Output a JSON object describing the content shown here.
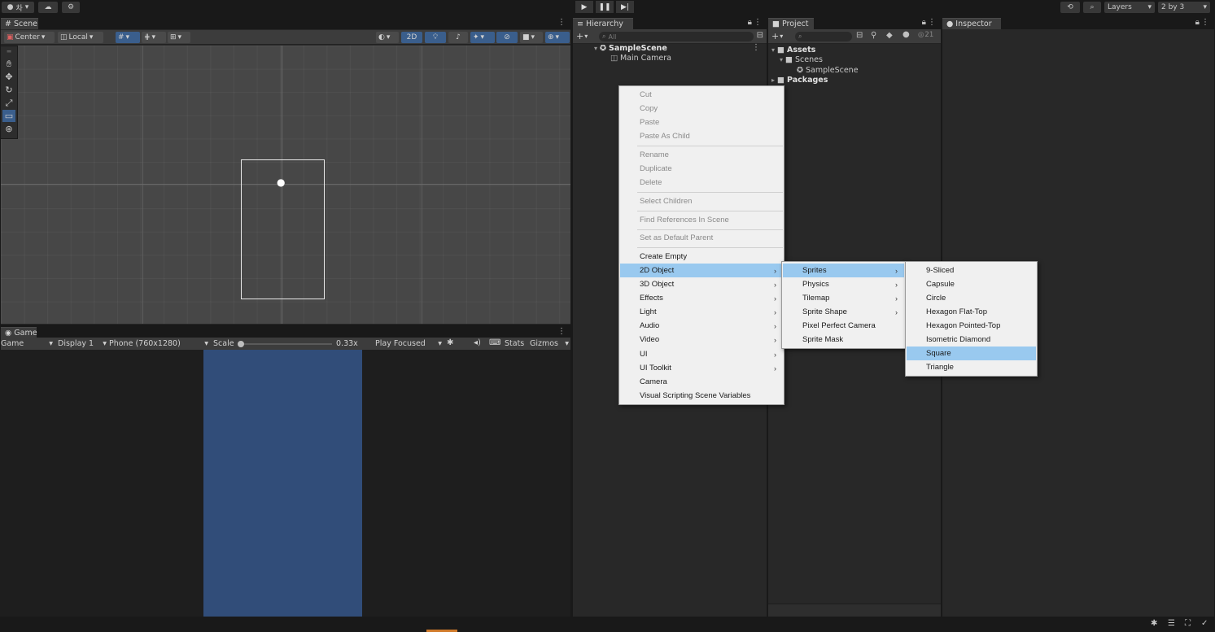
{
  "toolbar": {
    "account_label": "차",
    "layers_label": "Layers",
    "layout_label": "2 by 3"
  },
  "scene": {
    "tab_label": "Scene",
    "center_label": "Center",
    "local_label": "Local",
    "mode_2d_label": "2D"
  },
  "game": {
    "tab_label": "Game",
    "game_dropdown": "Game",
    "display_label": "Display 1",
    "resolution_label": "Phone (760x1280)",
    "scale_label": "Scale",
    "scale_value": "0.33x",
    "play_focused_label": "Play Focused",
    "stats_label": "Stats",
    "gizmos_label": "Gizmos",
    "background_color": "#314d79"
  },
  "hierarchy": {
    "tab_label": "Hierarchy",
    "search_placeholder": "All",
    "scene_name": "SampleScene",
    "items": [
      {
        "label": "Main Camera"
      }
    ]
  },
  "project": {
    "tab_label": "Project",
    "visible_count": "21",
    "tree": [
      {
        "label": "Assets"
      },
      {
        "label": "Scenes"
      },
      {
        "label": "SampleScene"
      },
      {
        "label": "Packages"
      }
    ]
  },
  "inspector": {
    "tab_label": "Inspector"
  },
  "context_menu": {
    "items": [
      {
        "label": "Cut",
        "disabled": true
      },
      {
        "label": "Copy",
        "disabled": true
      },
      {
        "label": "Paste",
        "disabled": true
      },
      {
        "label": "Paste As Child",
        "disabled": true
      },
      {
        "label": "Rename",
        "disabled": true
      },
      {
        "label": "Duplicate",
        "disabled": true
      },
      {
        "label": "Delete",
        "disabled": true
      },
      {
        "label": "Select Children",
        "disabled": true
      },
      {
        "label": "Find References In Scene",
        "disabled": true
      },
      {
        "label": "Set as Default Parent",
        "disabled": true
      },
      {
        "label": "Create Empty"
      },
      {
        "label": "2D Object",
        "submenu": true,
        "highlighted": true
      },
      {
        "label": "3D Object",
        "submenu": true
      },
      {
        "label": "Effects",
        "submenu": true
      },
      {
        "label": "Light",
        "submenu": true
      },
      {
        "label": "Audio",
        "submenu": true
      },
      {
        "label": "Video",
        "submenu": true
      },
      {
        "label": "UI",
        "submenu": true
      },
      {
        "label": "UI Toolkit",
        "submenu": true
      },
      {
        "label": "Camera"
      },
      {
        "label": "Visual Scripting Scene Variables"
      }
    ]
  },
  "submenu_2d": {
    "items": [
      {
        "label": "Sprites",
        "submenu": true,
        "highlighted": true
      },
      {
        "label": "Physics",
        "submenu": true
      },
      {
        "label": "Tilemap",
        "submenu": true
      },
      {
        "label": "Sprite Shape",
        "submenu": true
      },
      {
        "label": "Pixel Perfect Camera"
      },
      {
        "label": "Sprite Mask"
      }
    ]
  },
  "submenu_sprites": {
    "items": [
      {
        "label": "9-Sliced"
      },
      {
        "label": "Capsule"
      },
      {
        "label": "Circle"
      },
      {
        "label": "Hexagon Flat-Top"
      },
      {
        "label": "Hexagon Pointed-Top"
      },
      {
        "label": "Isometric Diamond"
      },
      {
        "label": "Square",
        "highlighted": true
      },
      {
        "label": "Triangle"
      }
    ]
  },
  "colors": {
    "menu_highlight": "#99c9ef",
    "accent_blue": "#3a5e8c"
  }
}
